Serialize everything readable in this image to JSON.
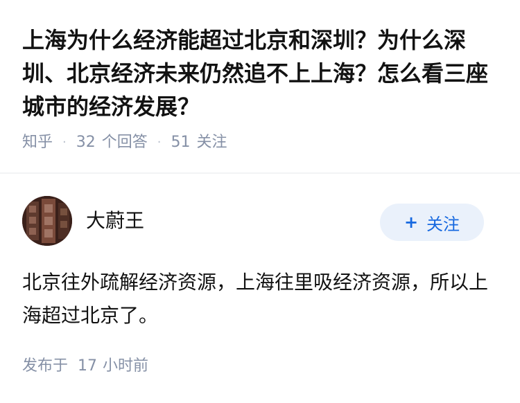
{
  "question": {
    "title": "上海为什么经济能超过北京和深圳？为什么深圳、北京经济未来仍然追不上上海？怎么看三座城市的经济发展？",
    "source": "知乎",
    "separator": "·",
    "answers_count": "32",
    "answers_label": "个回答",
    "followers_count": "51",
    "followers_label": "关注"
  },
  "author": {
    "name": "大蔚王",
    "follow_plus": "+",
    "follow_label": "关注"
  },
  "answer": {
    "content": "北京往外疏解经济资源，上海往里吸经济资源，所以上海超过北京了。",
    "published_prefix": "发布于",
    "published_num": "17",
    "published_suffix": "小时前"
  },
  "colors": {
    "meta_gray": "#8590a6",
    "follow_blue": "#1769e0",
    "follow_bg": "#eaf1fb",
    "text": "#121212"
  }
}
